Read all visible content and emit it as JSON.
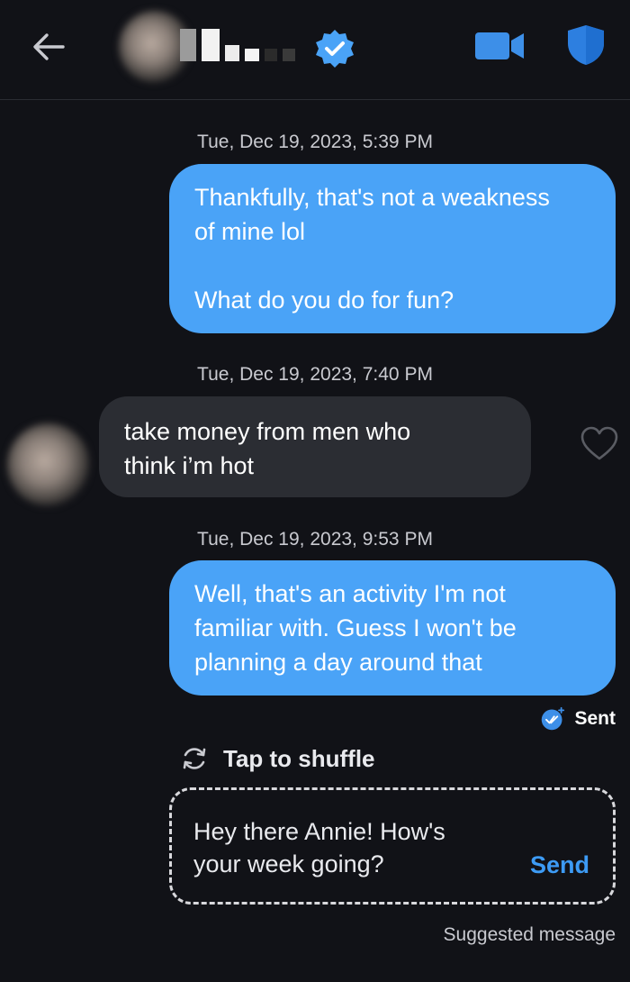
{
  "header": {
    "back_icon": "arrow-left-icon",
    "verified_icon": "verified-badge-icon",
    "video_icon": "video-camera-icon",
    "safety_icon": "shield-icon",
    "accent": "#4aa3f7"
  },
  "messages": [
    {
      "timestamp_date": "Tue, Dec 19, 2023,",
      "timestamp_time": "5:39 PM",
      "direction": "outgoing",
      "lines": [
        "Thankfully, that's not a weakness",
        "of mine lol",
        "",
        "What do you do for fun?"
      ]
    },
    {
      "timestamp_date": "Tue, Dec 19, 2023,",
      "timestamp_time": "7:40 PM",
      "direction": "incoming",
      "lines": [
        "take money from men who",
        "think i’m hot"
      ]
    },
    {
      "timestamp_date": "Tue, Dec 19, 2023,",
      "timestamp_time": "9:53 PM",
      "direction": "outgoing",
      "lines": [
        "Well, that's an activity I'm not",
        "familiar with. Guess I won't be",
        "planning a day around that"
      ]
    }
  ],
  "status": {
    "sent_label": "Sent"
  },
  "suggestion": {
    "shuffle_label": "Tap to shuffle",
    "text_line1": "Hey there Annie! How's",
    "text_line2": "your week going?",
    "send_label": "Send",
    "caption": "Suggested message"
  },
  "colors": {
    "background": "#111217",
    "outgoing_bubble": "#4aa3f7",
    "incoming_bubble": "#2b2d33",
    "send_blue": "#3d9bf5"
  }
}
